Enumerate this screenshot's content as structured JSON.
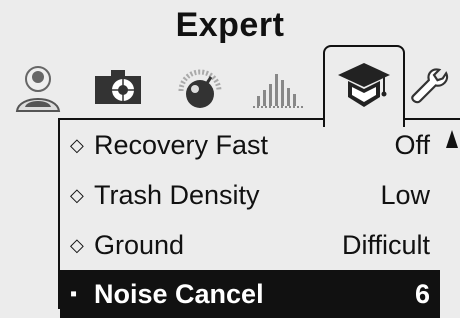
{
  "header": {
    "title": "Expert"
  },
  "tabs": [
    {
      "icon": "user-profile-icon",
      "active": false
    },
    {
      "icon": "camera-target-icon",
      "active": false
    },
    {
      "icon": "gauge-dial-icon",
      "active": false
    },
    {
      "icon": "bar-graph-icon",
      "active": false
    },
    {
      "icon": "graduation-cap-icon",
      "active": true
    },
    {
      "icon": "wrench-icon",
      "active": false
    }
  ],
  "menu": {
    "items": [
      {
        "bullet": "◇",
        "label": "Recovery Fast",
        "value": "Off",
        "selected": false
      },
      {
        "bullet": "◇",
        "label": "Trash Density",
        "value": "Low",
        "selected": false
      },
      {
        "bullet": "◇",
        "label": "Ground",
        "value": "Difficult",
        "selected": false
      },
      {
        "bullet": "▪",
        "label": "Noise Cancel",
        "value": "6",
        "selected": true
      }
    ]
  },
  "colors": {
    "background": "#ececec",
    "foreground": "#111111",
    "highlight_text": "#ffffff"
  }
}
